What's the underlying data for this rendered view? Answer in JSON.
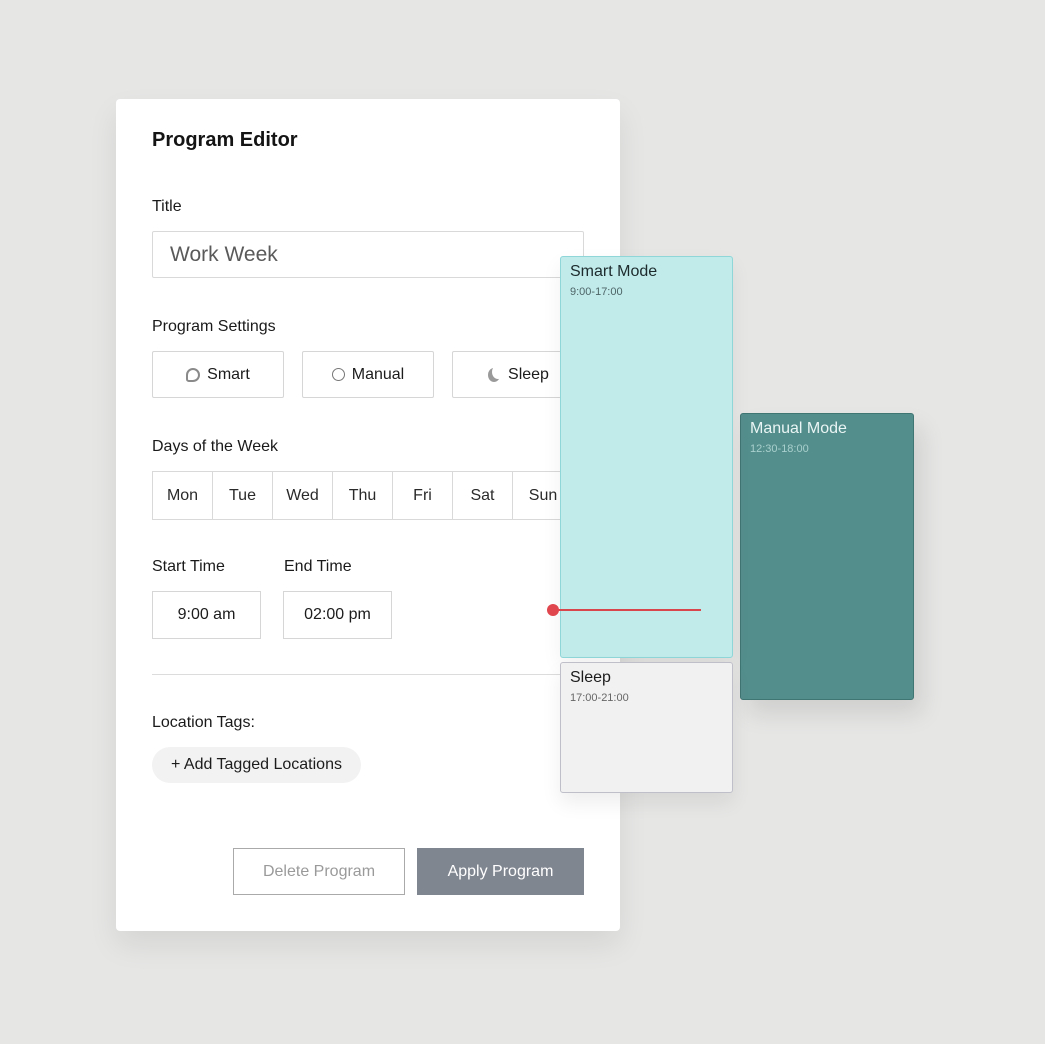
{
  "editor": {
    "title": "Program Editor",
    "title_label": "Title",
    "title_value": "Work Week",
    "settings_label": "Program Settings",
    "settings": [
      {
        "label": "Smart",
        "icon": "smart-icon"
      },
      {
        "label": "Manual",
        "icon": "manual-icon"
      },
      {
        "label": "Sleep",
        "icon": "moon-icon"
      }
    ],
    "days_label": "Days of the Week",
    "days": [
      "Mon",
      "Tue",
      "Wed",
      "Thu",
      "Fri",
      "Sat",
      "Sun"
    ],
    "start_time_label": "Start Time",
    "start_time_value": "9:00 am",
    "end_time_label": "End Time",
    "end_time_value": "02:00 pm",
    "location_label": "Location Tags:",
    "add_location_label": "+ Add Tagged Locations",
    "delete_label": "Delete Program",
    "apply_label": "Apply Program"
  },
  "schedule": {
    "blocks": [
      {
        "title": "Smart Mode",
        "time": "9:00-17:00",
        "color": "#c1eaeb"
      },
      {
        "title": "Manual Mode",
        "time": "12:30-18:00",
        "color": "#548e8c"
      },
      {
        "title": "Sleep",
        "time": "17:00-21:00",
        "color": "#f1f1f1"
      }
    ],
    "current_time_indicator_color": "#d9474d"
  }
}
